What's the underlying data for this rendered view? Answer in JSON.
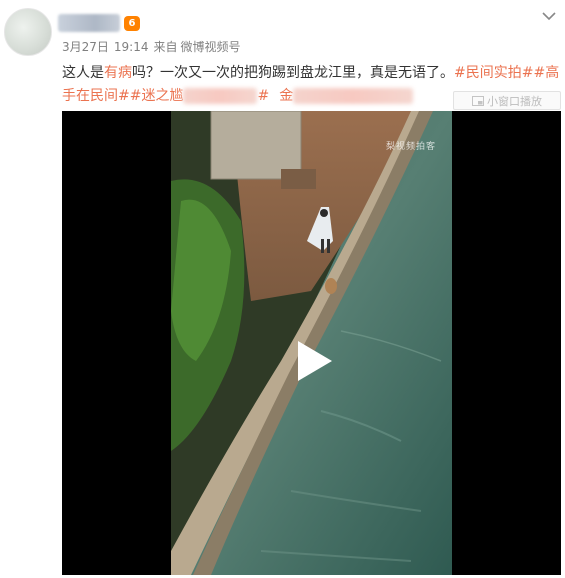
{
  "post": {
    "username": "▇▇▇▇▇",
    "vip_badge": "6",
    "date": "3月27日",
    "time": "19:14",
    "source_prefix": "来自",
    "source": "微博视频号",
    "text": {
      "p1": "这人是",
      "p2": "有病",
      "p3": "吗？一次又一次的把狗踢到盘龙江里，真是无语了。",
      "tag1": "#民间实拍#",
      "tag2": "#高手在民间#",
      "tag3a": "#迷之尴",
      "tag3b": "#",
      "tag4a": "金"
    }
  },
  "video": {
    "mini_window_label": "小窗口播放",
    "watermark": "梨视频拍客"
  },
  "colors": {
    "accent": "#eb7350",
    "meta_gray": "#808080",
    "vip_orange": "#ff8200"
  },
  "icons": [
    "chevron-down-icon",
    "mini-window-icon",
    "play-icon"
  ]
}
